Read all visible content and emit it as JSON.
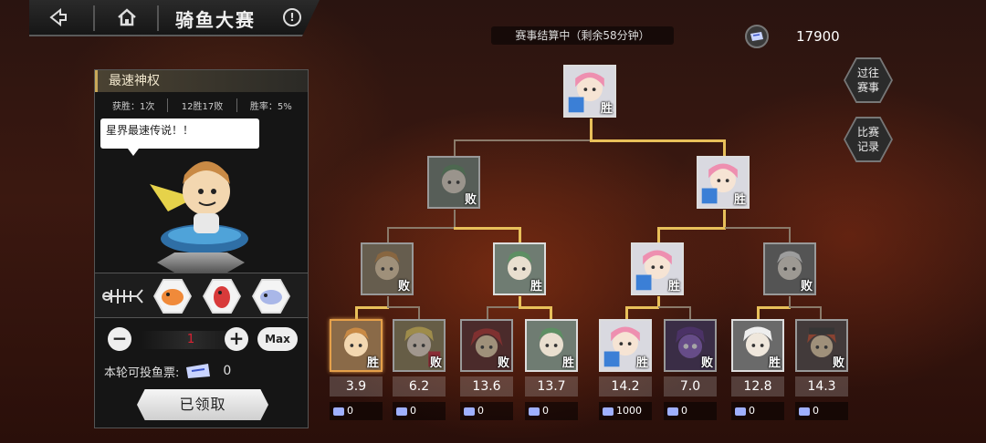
{
  "header": {
    "title": "骑鱼大赛",
    "status": "赛事结算中（剩余58分钟）",
    "currency_amount": "17900"
  },
  "side_buttons": {
    "past": "过往\n赛事",
    "records": "比赛\n记录"
  },
  "panel": {
    "title": "最速神权",
    "stats": [
      "获胜：1次",
      "12胜17败",
      "胜率：5%"
    ],
    "speech": "星界最速传说！！",
    "quantity": "1",
    "max_label": "Max",
    "vote_label": "本轮可投鱼票:",
    "vote_count": "0",
    "claim_label": "已领取"
  },
  "bracket": {
    "final": {
      "result": "胜"
    },
    "semis": [
      {
        "result": "败"
      },
      {
        "result": "胜"
      }
    ],
    "quarters": [
      {
        "result": "败"
      },
      {
        "result": "胜"
      },
      {
        "result": "胜"
      },
      {
        "result": "败"
      }
    ],
    "racers": [
      {
        "result": "胜",
        "odds": "3.9",
        "bets": "0"
      },
      {
        "result": "败",
        "odds": "6.2",
        "bets": "0"
      },
      {
        "result": "败",
        "odds": "13.6",
        "bets": "0"
      },
      {
        "result": "胜",
        "odds": "13.7",
        "bets": "0"
      },
      {
        "result": "胜",
        "odds": "14.2",
        "bets": "1000"
      },
      {
        "result": "败",
        "odds": "7.0",
        "bets": "0"
      },
      {
        "result": "胜",
        "odds": "12.8",
        "bets": "0"
      },
      {
        "result": "败",
        "odds": "14.3",
        "bets": "0"
      }
    ]
  },
  "colors": {
    "win_line": "#e8c05a",
    "accent_gold": "#c9a859",
    "qty_red": "#dd2233"
  }
}
